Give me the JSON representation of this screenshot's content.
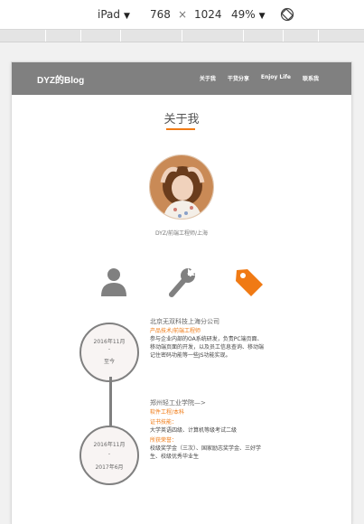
{
  "devtools": {
    "device": "iPad",
    "width": "768",
    "times": "×",
    "height": "1024",
    "zoom": "49%"
  },
  "site": {
    "brand": "DYZ的Blog",
    "nav": [
      "关于我",
      "干货分享",
      "Enjoy Life",
      "联系我"
    ]
  },
  "about": {
    "title": "关于我",
    "subtitle": "DYZ/前端工程师/上海"
  },
  "timeline": [
    {
      "date_start": "2016年11月",
      "date_sep": "-",
      "date_end": "至今",
      "company": "北京无双科技上海分公司",
      "role": "产品技术/前端工程师",
      "desc_lines": [
        "参与企业内部的OA系统研发，负责PC端页面、",
        "移动端页面的开发，以及员工信息查询、移动端",
        "记住密码功能等一些JS功能实现。"
      ]
    },
    {
      "date_start": "2016年11月",
      "date_sep": "-",
      "date_end": "2017年6月",
      "company": "郑州轻工业学院—>",
      "role": "软件工程/本科",
      "cert_label": "证书技能：",
      "cert_text": "大学英语四级、计算机等级考试二级",
      "honor_label": "所获荣誉：",
      "honor_lines": [
        "校级奖学金（三次）、国家励志奖学金、三好学",
        "生、校级优秀毕业生"
      ]
    }
  ],
  "colors": {
    "accent": "#f07a14",
    "navbar": "#808080",
    "icon_gray": "#808080"
  },
  "icons": [
    "person-icon",
    "wrench-icon",
    "tag-icon"
  ]
}
